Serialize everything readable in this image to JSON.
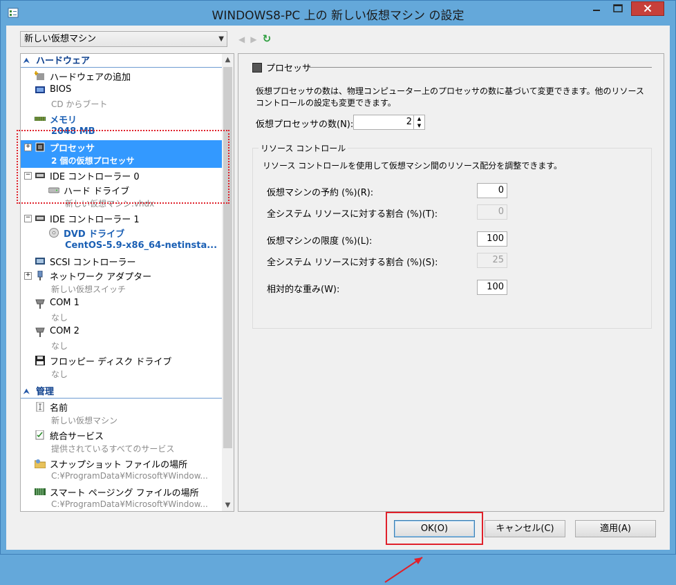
{
  "window": {
    "title": "WINDOWS8-PC 上の 新しい仮想マシン の設定"
  },
  "vm_select": {
    "value": "新しい仮想マシン"
  },
  "tree": {
    "hardware_header": "ハードウェア",
    "items": [
      {
        "label": "ハードウェアの追加"
      },
      {
        "label": "BIOS",
        "sub": "CD からブート"
      },
      {
        "label": "メモリ",
        "sub": "2048 MB"
      },
      {
        "label": "プロセッサ",
        "sub": "2 個の仮想プロセッサ"
      },
      {
        "label": "IDE コントローラー 0"
      },
      {
        "label": "ハード ドライブ",
        "sub": "新しい仮想マシン.vhdx"
      },
      {
        "label": "IDE コントローラー 1"
      },
      {
        "label": "DVD ドライブ",
        "sub": "CentOS-5.9-x86_64-netinsta..."
      },
      {
        "label": "SCSI コントローラー"
      },
      {
        "label": "ネットワーク アダプター",
        "sub": "新しい仮想スイッチ"
      },
      {
        "label": "COM 1",
        "sub": "なし"
      },
      {
        "label": "COM 2",
        "sub": "なし"
      },
      {
        "label": "フロッピー ディスク ドライブ",
        "sub": "なし"
      }
    ],
    "management_header": "管理",
    "mgmt_items": [
      {
        "label": "名前",
        "sub": "新しい仮想マシン"
      },
      {
        "label": "統合サービス",
        "sub": "提供されているすべてのサービス"
      },
      {
        "label": "スナップショット ファイルの場所",
        "sub": "C:¥ProgramData¥Microsoft¥Window..."
      },
      {
        "label": "スマート ページング ファイルの場所",
        "sub": "C:¥ProgramData¥Microsoft¥Window..."
      }
    ]
  },
  "panel": {
    "title": "プロセッサ",
    "description": "仮想プロセッサの数は、物理コンピューター上のプロセッサの数に基づいて変更できます。他のリソース コントロールの設定も変更できます。",
    "cpu_count_label": "仮想プロセッサの数(N):",
    "cpu_count_value": "2",
    "resource_group": {
      "title": "リソース コントロール",
      "description": "リソース コントロールを使用して仮想マシン間のリソース配分を調整できます。",
      "reserve_label": "仮想マシンの予約 (%)(R):",
      "reserve_value": "0",
      "reserve_total_label": "全システム リソースに対する割合 (%)(T):",
      "reserve_total_value": "0",
      "limit_label": "仮想マシンの限度 (%)(L):",
      "limit_value": "100",
      "limit_total_label": "全システム リソースに対する割合 (%)(S):",
      "limit_total_value": "25",
      "weight_label": "相対的な重み(W):",
      "weight_value": "100"
    }
  },
  "buttons": {
    "ok": "OK(O)",
    "cancel": "キャンセル(C)",
    "apply": "適用(A)"
  },
  "colors": {
    "title_bar": "#64A8DA",
    "selection": "#3399FF",
    "highlight": "#E0202A",
    "section": "#0B3E8C"
  }
}
